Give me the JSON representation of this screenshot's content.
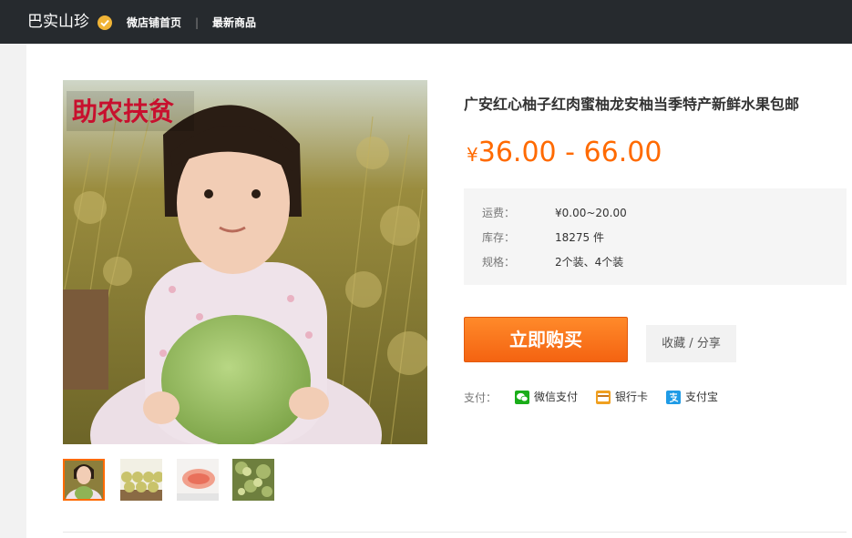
{
  "header": {
    "shop_name": "巴实山珍",
    "nav": [
      "微店铺首页",
      "最新商品"
    ],
    "separator": "|"
  },
  "product": {
    "title": "广安红心柚子红肉蜜柚龙安柚当季特产新鲜水果包邮",
    "price_symbol": "¥",
    "price_range": "36.00 - 66.00",
    "image_watermark": "助农扶贫",
    "info": [
      {
        "label": "运费：",
        "value": "¥0.00~20.00"
      },
      {
        "label": "库存：",
        "value": "18275 件"
      },
      {
        "label": "规格：",
        "value": "2个装、4个装"
      }
    ],
    "thumbnails": [
      "thumb-girl-pomelo",
      "thumb-pomelo-crates",
      "thumb-pomelo-flesh",
      "thumb-pomelo-tree"
    ],
    "active_thumbnail": 0
  },
  "actions": {
    "buy_label": "立即购买",
    "favorite_label": "收藏 / 分享"
  },
  "payment": {
    "label": "支付：",
    "methods": [
      {
        "name": "微信支付",
        "icon": "wechat-pay-icon",
        "color": "#1aad19"
      },
      {
        "name": "银行卡",
        "icon": "bank-card-icon",
        "color": "#f0a020"
      },
      {
        "name": "支付宝",
        "icon": "alipay-icon",
        "color": "#1f9be6"
      }
    ]
  },
  "colors": {
    "accent": "#ff6a00",
    "topbar": "#262a2e"
  }
}
